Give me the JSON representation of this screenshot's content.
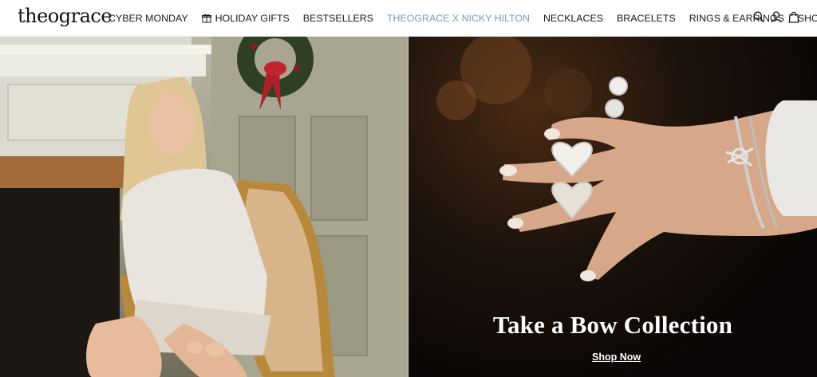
{
  "brand": {
    "logo_text": "theograce"
  },
  "nav": {
    "items": [
      {
        "label": "CYBER MONDAY"
      },
      {
        "label": "HOLIDAY GIFTS",
        "icon": "gift-icon"
      },
      {
        "label": "BESTSELLERS"
      },
      {
        "label": "THEOGRACE X NICKY HILTON",
        "highlight_color": "#6f9fb8"
      },
      {
        "label": "NECKLACES"
      },
      {
        "label": "BRACELETS"
      },
      {
        "label": "RINGS & EARRINGS"
      },
      {
        "label": "SHOP BY"
      }
    ]
  },
  "header_icons": [
    "search-icon",
    "account-icon",
    "cart-icon"
  ],
  "hero": {
    "heading": "Take a Bow Collection",
    "cta_label": "Shop Now",
    "left_image": "woman-seated-in-gilded-chair-with-wreath",
    "right_image": "hand-wearing-heart-locket-rings-and-bow-bracelets"
  },
  "colors": {
    "nav_highlight": "#6f9fb8",
    "text": "#1a1a1a",
    "hero_text": "#ffffff"
  }
}
